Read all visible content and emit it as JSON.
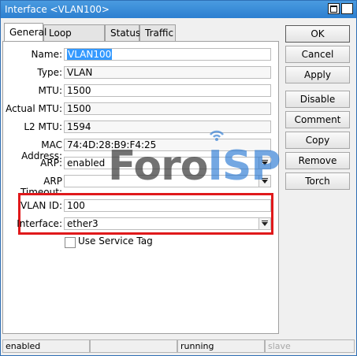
{
  "window": {
    "title": "Interface <VLAN100>"
  },
  "tabs": [
    "General",
    "Loop Protect",
    "Status",
    "Traffic"
  ],
  "fields": {
    "name": {
      "label": "Name:",
      "value": "VLAN100"
    },
    "type": {
      "label": "Type:",
      "value": "VLAN"
    },
    "mtu": {
      "label": "MTU:",
      "value": "1500"
    },
    "actual_mtu": {
      "label": "Actual MTU:",
      "value": "1500"
    },
    "l2_mtu": {
      "label": "L2 MTU:",
      "value": "1594"
    },
    "mac": {
      "label": "MAC Address:",
      "value": "74:4D:28:B9:F4:25"
    },
    "arp": {
      "label": "ARP:",
      "value": "enabled"
    },
    "arp_timeout": {
      "label": "ARP Timeout:",
      "value": ""
    },
    "vlan_id": {
      "label": "VLAN ID:",
      "value": "100"
    },
    "interface": {
      "label": "Interface:",
      "value": "ether3"
    }
  },
  "checkbox": {
    "label": "Use Service Tag",
    "checked": false
  },
  "buttons": [
    "OK",
    "Cancel",
    "Apply",
    "Disable",
    "Comment",
    "Copy",
    "Remove",
    "Torch"
  ],
  "watermark": {
    "text1": "Foro",
    "text2": "ISP"
  },
  "status": [
    "enabled",
    "",
    "running",
    "slave"
  ],
  "colors": {
    "highlight_border": "#e0191b",
    "title_bar": "#2c7fd0"
  }
}
